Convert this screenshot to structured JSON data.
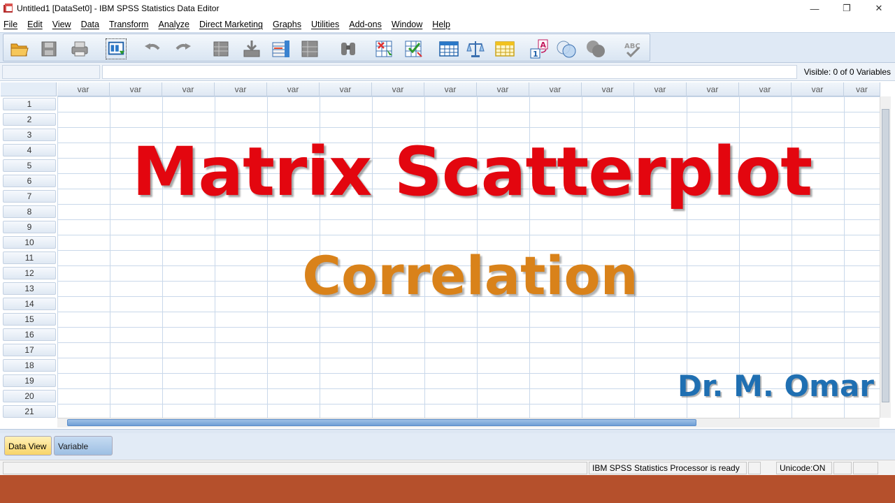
{
  "window": {
    "title": "Untitled1 [DataSet0] - IBM SPSS Statistics Data Editor",
    "minimize": "—",
    "restore": "❐",
    "close": "✕"
  },
  "menu": [
    "File",
    "Edit",
    "View",
    "Data",
    "Transform",
    "Analyze",
    "Direct Marketing",
    "Graphs",
    "Utilities",
    "Add-ons",
    "Window",
    "Help"
  ],
  "toolbar": {
    "icons": [
      "open-folder-icon",
      "save-icon",
      "print-icon",
      "recall-dialog-icon",
      "undo-icon",
      "redo-icon",
      "goto-case-icon",
      "goto-variable-icon",
      "variables-icon",
      "run-descriptive-icon",
      "find-icon",
      "insert-cases-icon",
      "insert-variable-icon",
      "split-file-icon",
      "weight-cases-icon",
      "select-cases-icon",
      "value-labels-icon",
      "use-sets-icon",
      "show-all-variables-icon",
      "spell-check-icon"
    ],
    "value_labels_text": "A 1",
    "spell_text": "ABC"
  },
  "cell_editor": {
    "cell_ref": "",
    "cell_value": "",
    "visible": "Visible: 0 of 0 Variables"
  },
  "grid": {
    "column_header": "var",
    "columns": [
      "var",
      "var",
      "var",
      "var",
      "var",
      "var",
      "var",
      "var",
      "var",
      "var",
      "var",
      "var",
      "var",
      "var",
      "var",
      "var"
    ],
    "rows": [
      "1",
      "2",
      "3",
      "4",
      "5",
      "6",
      "7",
      "8",
      "9",
      "10",
      "11",
      "12",
      "13",
      "14",
      "15",
      "16",
      "17",
      "18",
      "19",
      "20",
      "21"
    ]
  },
  "overlay": {
    "title": "Matrix Scatterplot",
    "subtitle": "Correlation",
    "author": "Dr. M. Omar",
    "title_color": "#e3060f",
    "subtitle_color": "#d9821a",
    "author_color": "#1f6fb2"
  },
  "tabs": {
    "data_view": "Data View",
    "variable_view": "Variable View"
  },
  "status": {
    "processor": "IBM SPSS Statistics Processor is ready",
    "unicode": "Unicode:ON"
  },
  "colors": {
    "bottom_strip": "#b5502c",
    "grid_line": "#c9d8ea"
  }
}
